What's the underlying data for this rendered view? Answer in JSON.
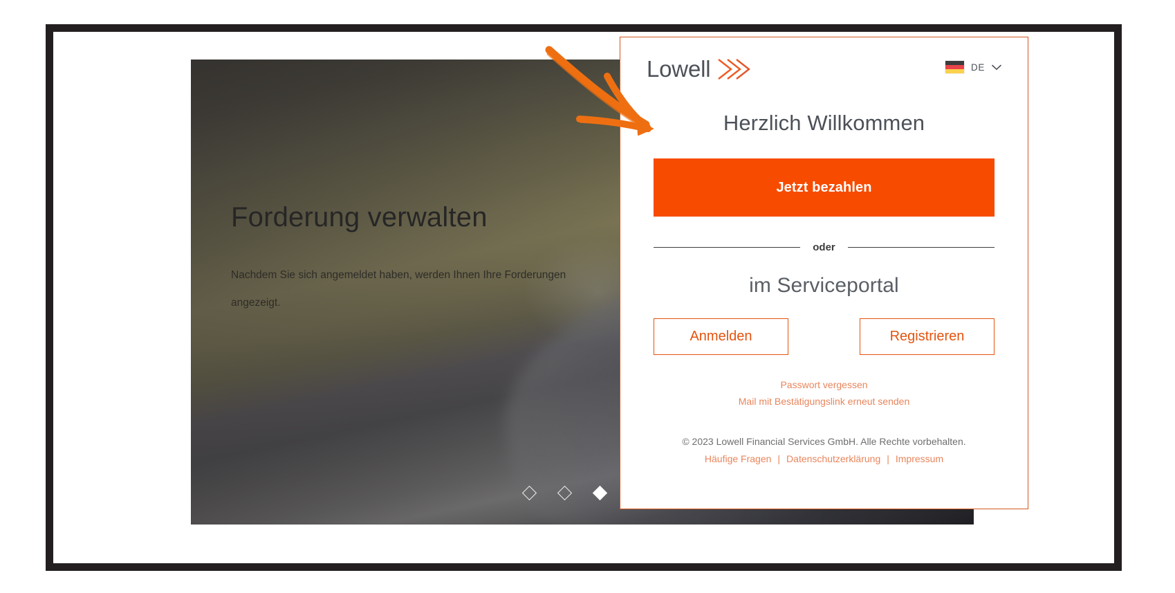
{
  "colors": {
    "brand_orange": "#f74b00",
    "outline_orange": "#e4530e",
    "link_orange": "#e8855c",
    "panel_border": "#d4561e",
    "logo_gray": "#4c5158",
    "frame_dark": "#231f20",
    "annotation_orange": "#ee6f11"
  },
  "hero": {
    "title": "Forderung verwalten",
    "subtitle": "Nachdem Sie sich angemeldet haben, werden Ihnen Ihre Forderungen angezeigt.",
    "carousel": {
      "total_slides": 4,
      "active_index": 2,
      "dot_icon": "diamond-icon"
    }
  },
  "panel": {
    "logo": {
      "word": "Lowell",
      "mark_icon": "lowell-chevrons-icon"
    },
    "language": {
      "flag_icon": "flag-de-icon",
      "code": "DE",
      "chevron_icon": "chevron-down-icon"
    },
    "welcome_title": "Herzlich Willkommen",
    "pay_now_label": "Jetzt bezahlen",
    "or_label": "oder",
    "serviceportal_title": "im Serviceportal",
    "auth_buttons": [
      {
        "label": "Anmelden",
        "name": "login-button"
      },
      {
        "label": "Registrieren",
        "name": "register-button"
      }
    ],
    "helper_links": [
      {
        "label": "Passwort vergessen",
        "name": "forgot-password-link"
      },
      {
        "label": "Mail mit Bestätigungslink erneut senden",
        "name": "resend-confirmation-link"
      }
    ],
    "footer": {
      "copyright": "© 2023 Lowell Financial Services GmbH. Alle Rechte vorbehalten.",
      "links": [
        {
          "label": "Häufige Fragen",
          "name": "faq-link"
        },
        {
          "label": "Datenschutzerklärung",
          "name": "privacy-policy-link"
        },
        {
          "label": "Impressum",
          "name": "imprint-link"
        }
      ],
      "separator": "|"
    }
  },
  "annotation": {
    "type": "hand-drawn-arrow",
    "points_to": "Jetzt bezahlen"
  }
}
